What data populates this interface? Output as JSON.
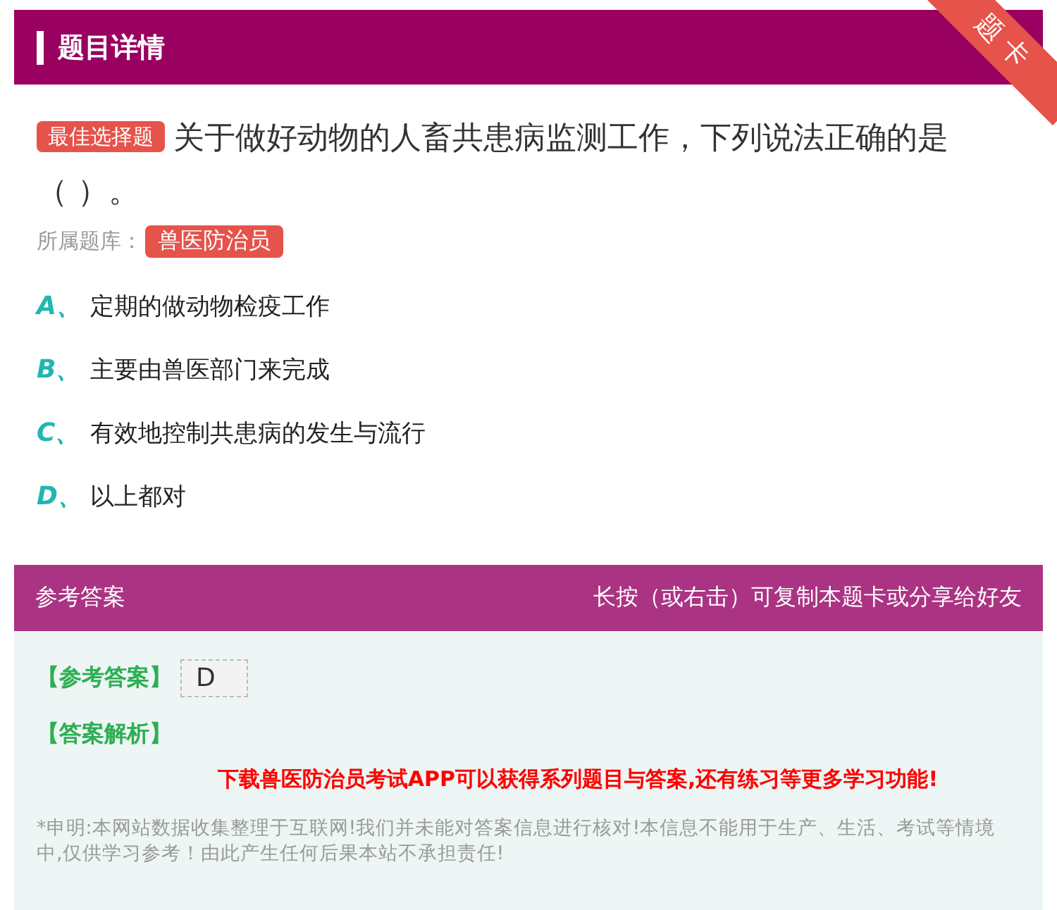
{
  "header": {
    "title": "题目详情",
    "ribbon": "题卡"
  },
  "question": {
    "type_tag": "最佳选择题",
    "text": "关于做好动物的人畜共患病监测工作，下列说法正确的是（ ）。",
    "bank_label": "所属题库：",
    "bank_tag": "兽医防治员"
  },
  "options": [
    {
      "letter": "A、",
      "text": "定期的做动物检疫工作"
    },
    {
      "letter": "B、",
      "text": "主要由兽医部门来完成"
    },
    {
      "letter": "C、",
      "text": "有效地控制共患病的发生与流行"
    },
    {
      "letter": "D、",
      "text": "以上都对"
    }
  ],
  "answer_bar": {
    "title": "参考答案",
    "hint": "长按（或右击）可复制本题卡或分享给好友"
  },
  "answer": {
    "label": "【参考答案】",
    "value": "D",
    "analysis_label": "【答案解析】",
    "promo": "下载兽医防治员考试APP可以获得系列题目与答案,还有练习等更多学习功能!",
    "disclaimer": "*申明:本网站数据收集整理于互联网!我们并未能对答案信息进行核对!本信息不能用于生产、生活、考试等情境中,仅供学习参考！由此产生任何后果本站不承担责任!"
  }
}
